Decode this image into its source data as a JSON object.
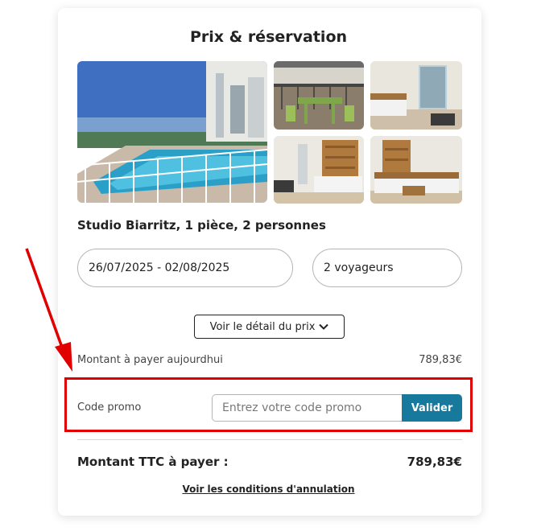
{
  "card": {
    "title": "Prix & réservation",
    "listing_title": "Studio Biarritz, 1 pièce, 2 personnes"
  },
  "photos": [
    {
      "name": "pool-exterior-photo"
    },
    {
      "name": "balcony-photo"
    },
    {
      "name": "bedroom-photo"
    },
    {
      "name": "living-room-photo"
    },
    {
      "name": "sofa-room-photo"
    }
  ],
  "booking": {
    "dates": "26/07/2025 - 02/08/2025",
    "travelers": "2 voyageurs"
  },
  "price": {
    "detail_button_label": "Voir le détail du prix",
    "today_label": "Montant à payer aujourdhui",
    "today_value": "789,83€",
    "promo_label": "Code promo",
    "promo_placeholder": "Entrez votre code promo",
    "promo_value": "",
    "promo_button": "Valider",
    "total_label": "Montant TTC à payer :",
    "total_value": "789,83€",
    "cancel_link": "Voir les conditions d'annulation"
  },
  "annotation": {
    "highlight_color": "#e00000",
    "arrow_color": "#e00000"
  },
  "colors": {
    "accent": "#17799c",
    "text": "#222222"
  }
}
